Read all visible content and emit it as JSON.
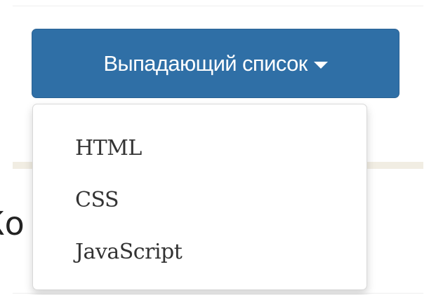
{
  "dropdown": {
    "toggle_label": "Выпадающий список",
    "caret_icon": "caret-down-icon",
    "items": [
      {
        "label": "HTML"
      },
      {
        "label": "CSS"
      },
      {
        "label": "JavaScript"
      }
    ]
  },
  "background": {
    "heading_fragment": "Ко"
  },
  "colors": {
    "toggle_background": "#2f6fa6",
    "toggle_text": "#ffffff",
    "menu_background": "#ffffff",
    "menu_text": "#333333"
  }
}
